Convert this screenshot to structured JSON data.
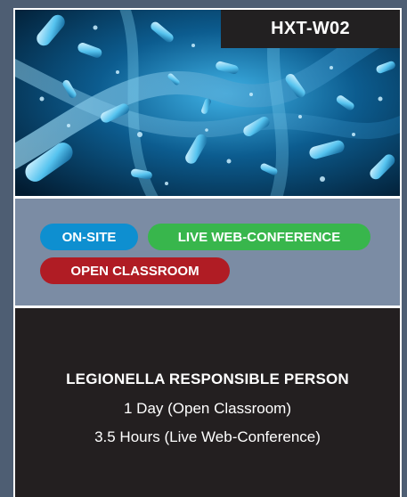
{
  "card": {
    "course_code": "HXT-W02",
    "hero_image": "legionella-bacteria-illustration",
    "delivery_tags": [
      {
        "label": "ON-SITE",
        "color": "#0e8fd0"
      },
      {
        "label": "LIVE WEB-CONFERENCE",
        "color": "#38b64c"
      },
      {
        "label": "OPEN CLASSROOM",
        "color": "#b01c24"
      }
    ],
    "course_title": "LEGIONELLA RESPONSIBLE PERSON",
    "durations": [
      "1 Day (Open Classroom)",
      "3.5 Hours (Live Web-Conference)"
    ]
  },
  "colors": {
    "page_background": "#4e5e73",
    "tags_panel": "#7b8ca4",
    "info_panel": "#231f20",
    "code_tag_background": "#222021"
  }
}
